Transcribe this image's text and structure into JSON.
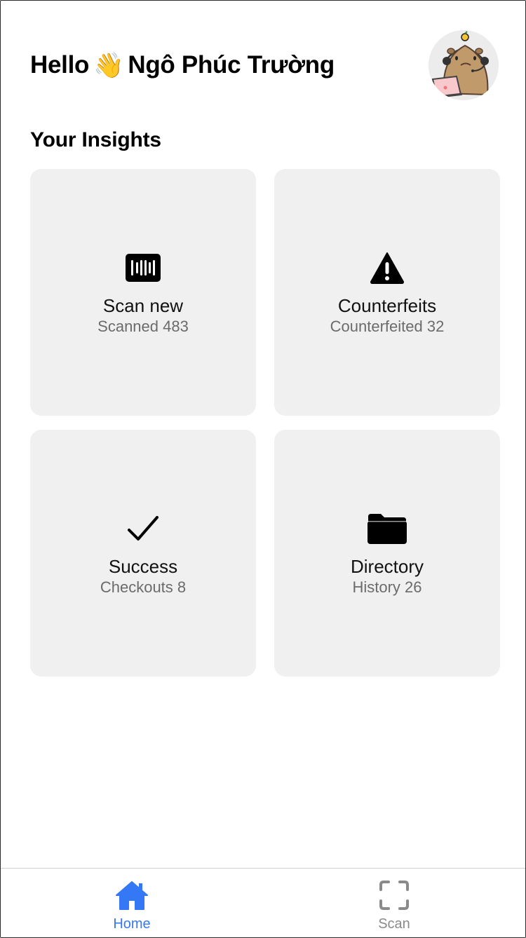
{
  "header": {
    "greeting_prefix": "Hello",
    "wave_emoji": "👋",
    "user_name": "Ngô Phúc Trường"
  },
  "insights": {
    "title": "Your Insights",
    "cards": [
      {
        "title": "Scan new",
        "subtitle": "Scanned 483",
        "icon": "barcode-icon"
      },
      {
        "title": "Counterfeits",
        "subtitle": "Counterfeited 32",
        "icon": "warning-icon"
      },
      {
        "title": "Success",
        "subtitle": "Checkouts 8",
        "icon": "checkmark-icon"
      },
      {
        "title": "Directory",
        "subtitle": "History 26",
        "icon": "folder-icon"
      }
    ]
  },
  "tabbar": {
    "tabs": [
      {
        "label": "Home",
        "icon": "home-icon",
        "active": true
      },
      {
        "label": "Scan",
        "icon": "scan-frame-icon",
        "active": false
      }
    ]
  },
  "colors": {
    "accent": "#3478f6",
    "card_bg": "#f0f0f0",
    "subtitle": "#6b6b6b",
    "inactive_tab": "#8a8a8a"
  }
}
